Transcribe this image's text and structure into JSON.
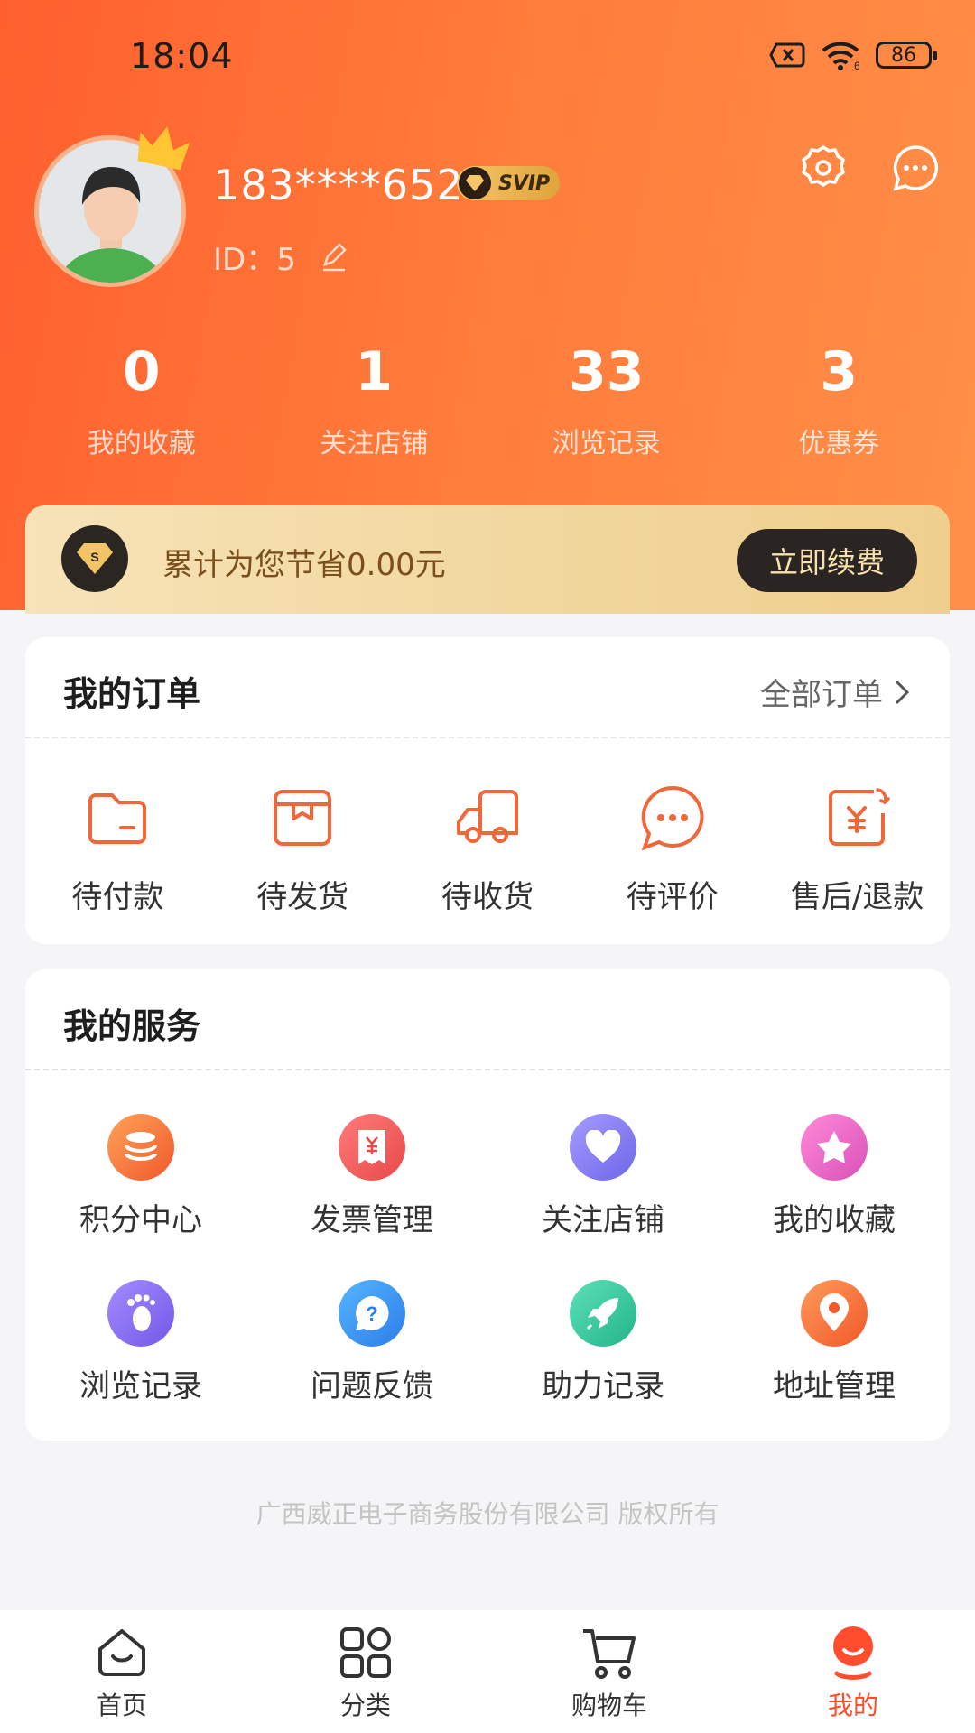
{
  "status_bar": {
    "time": "18:04",
    "battery": "86"
  },
  "colors": {
    "brand": "#ff6a33",
    "accent_red": "#ff4d2e",
    "gold": "#f1d69c",
    "icon_orange": "#f0673a"
  },
  "profile": {
    "phone": "183****6524",
    "badge": "SVIP",
    "id_label": "ID：",
    "id_value": "5"
  },
  "stats": [
    {
      "value": "0",
      "label": "我的收藏"
    },
    {
      "value": "1",
      "label": "关注店铺"
    },
    {
      "value": "33",
      "label": "浏览记录"
    },
    {
      "value": "3",
      "label": "优惠券"
    }
  ],
  "vip": {
    "text": "累计为您节省0.00元",
    "button": "立即续费"
  },
  "orders": {
    "title": "我的订单",
    "all_label": "全部订单",
    "items": [
      {
        "label": "待付款",
        "icon": "wallet-icon"
      },
      {
        "label": "待发货",
        "icon": "box-icon"
      },
      {
        "label": "待收货",
        "icon": "truck-icon"
      },
      {
        "label": "待评价",
        "icon": "chat-icon"
      },
      {
        "label": "售后/退款",
        "icon": "refund-icon"
      }
    ]
  },
  "services": {
    "title": "我的服务",
    "items": [
      {
        "label": "积分中心",
        "icon": "coins-icon"
      },
      {
        "label": "发票管理",
        "icon": "invoice-icon"
      },
      {
        "label": "关注店铺",
        "icon": "heart-icon"
      },
      {
        "label": "我的收藏",
        "icon": "star-icon"
      },
      {
        "label": "浏览记录",
        "icon": "footprint-icon"
      },
      {
        "label": "问题反馈",
        "icon": "question-icon"
      },
      {
        "label": "助力记录",
        "icon": "rocket-icon"
      },
      {
        "label": "地址管理",
        "icon": "location-icon"
      }
    ]
  },
  "footer": {
    "copyright": "广西威正电子商务股份有限公司 版权所有"
  },
  "tabs": [
    {
      "label": "首页",
      "icon": "home-icon"
    },
    {
      "label": "分类",
      "icon": "grid-icon"
    },
    {
      "label": "购物车",
      "icon": "cart-icon"
    },
    {
      "label": "我的",
      "icon": "user-icon",
      "active": true
    }
  ]
}
